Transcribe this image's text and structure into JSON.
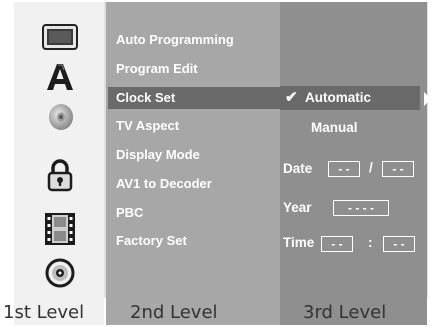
{
  "menu": {
    "items": [
      {
        "label": "Auto Programming"
      },
      {
        "label": "Program Edit"
      },
      {
        "label": "Clock Set"
      },
      {
        "label": "TV Aspect"
      },
      {
        "label": "Display Mode"
      },
      {
        "label": "AV1 to Decoder"
      },
      {
        "label": "PBC"
      },
      {
        "label": "Factory Set"
      }
    ],
    "selected_index": 2
  },
  "level1_icons": [
    "tv-icon",
    "letter-a-icon",
    "speaker-disc-icon",
    "lock-icon",
    "film-icon",
    "disc-icon"
  ],
  "options": {
    "automatic": "Automatic",
    "manual": "Manual",
    "checkmark": "✔"
  },
  "fields": {
    "date_label": "Date",
    "date_part1": "- -",
    "date_sep": "/",
    "date_part2": "- -",
    "year_label": "Year",
    "year_value": "- - - -",
    "time_label": "Time",
    "time_part1": "- -",
    "time_sep": ":",
    "time_part2": "- -"
  },
  "levels": {
    "first": "1st Level",
    "second": "2nd Level",
    "third": "3rd Level"
  },
  "colors": {
    "level1_bg": "#f1f1f1",
    "level2_bg": "#a7a7a7",
    "level3_bg": "#8f8f8f",
    "highlight": "#6a6a6a"
  }
}
